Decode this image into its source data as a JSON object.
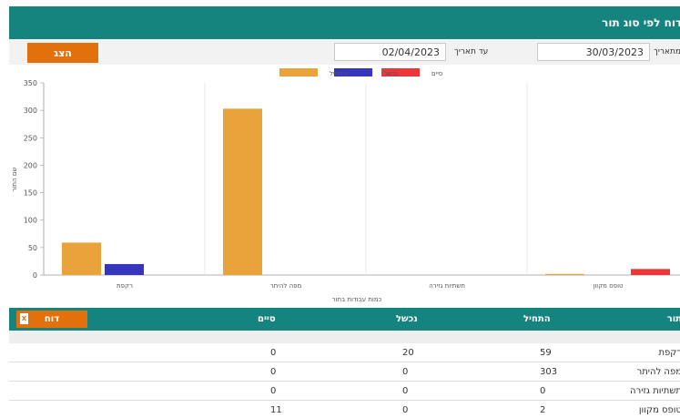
{
  "header": {
    "title": "דוח לפי סוג תור"
  },
  "filters": {
    "from_label": "מתאריך",
    "from_value": "30/03/2023",
    "to_label": "עד תאריך",
    "to_value": "02/04/2023",
    "show_button": "הצג"
  },
  "chart_data": {
    "type": "bar",
    "categories": [
      "רקפת",
      "מפה להיתר",
      "תשתיות גזירה",
      "טופס מקוון"
    ],
    "series": [
      {
        "name": "התחיל",
        "color": "#eaa23a",
        "values": [
          59,
          303,
          0,
          2
        ]
      },
      {
        "name": "נכשל",
        "color": "#3636bd",
        "values": [
          20,
          0,
          0,
          0
        ]
      },
      {
        "name": "סיים",
        "color": "#ee3538",
        "values": [
          0,
          0,
          0,
          11
        ]
      }
    ],
    "y_ticks": [
      "0",
      "50",
      "100",
      "150",
      "200",
      "250",
      "300",
      "350"
    ],
    "ylim": [
      0,
      350
    ],
    "xlabel": "כמות עבודות בתור",
    "ylabel": "שם התור",
    "legend_position": "top-center",
    "grid": true
  },
  "table": {
    "columns": [
      "תור",
      "התחיל",
      "נכשל",
      "סיים"
    ],
    "report_button": "דוח",
    "excel_icon": "X",
    "rows": [
      {
        "name": "רקפת",
        "started": "59",
        "failed": "20",
        "finished": "0"
      },
      {
        "name": "מפה להיתר",
        "started": "303",
        "failed": "0",
        "finished": "0"
      },
      {
        "name": "תשתיות גזירה",
        "started": "0",
        "failed": "0",
        "finished": "0"
      },
      {
        "name": "טופס מקוון",
        "started": "2",
        "failed": "0",
        "finished": "11"
      }
    ]
  }
}
